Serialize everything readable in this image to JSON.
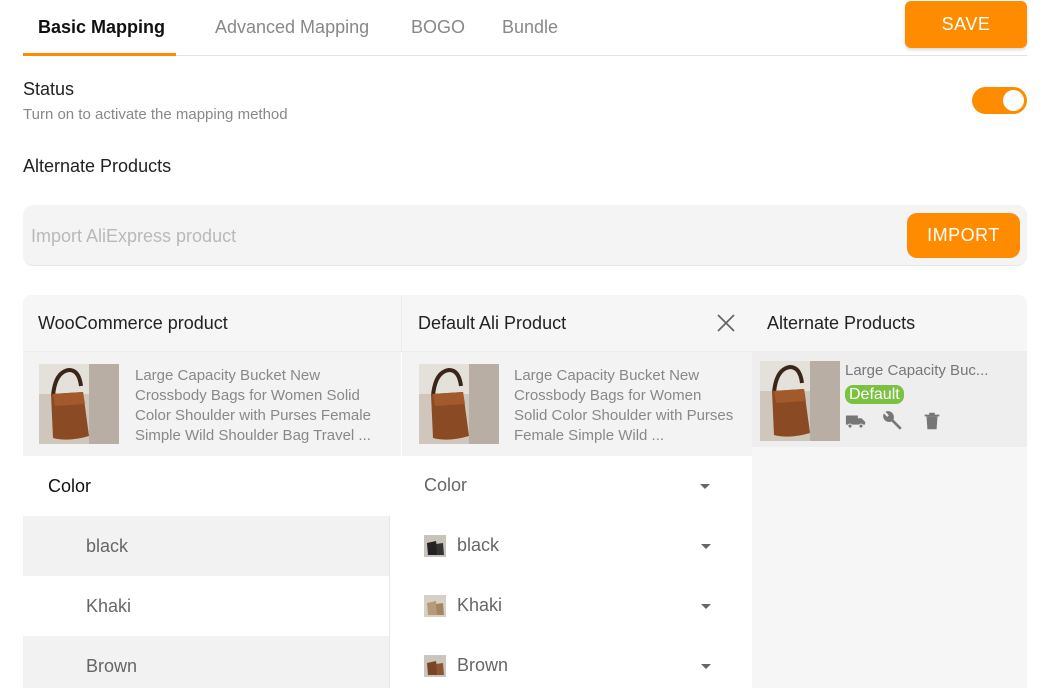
{
  "tabs": [
    {
      "label": "Basic Mapping",
      "active": true
    },
    {
      "label": "Advanced Mapping",
      "active": false
    },
    {
      "label": "BOGO",
      "active": false
    },
    {
      "label": "Bundle",
      "active": false
    }
  ],
  "save_label": "SAVE",
  "status": {
    "title": "Status",
    "description": "Turn on to activate the mapping method",
    "enabled": true
  },
  "alternate_section_title": "Alternate Products",
  "import": {
    "placeholder": "Import AliExpress product",
    "button_label": "IMPORT"
  },
  "columns": {
    "woo": "WooCommerce product",
    "ali": "Default Ali Product",
    "alt": "Alternate Products"
  },
  "woo_product": {
    "title": "Large Capacity Bucket New Crossbody Bags for Women Solid Color Shoulder with Purses Female Simple Wild Shoulder Bag Travel ..."
  },
  "ali_product": {
    "title": "Large Capacity Bucket New Crossbody Bags for Women Solid Color Shoulder with Purses Female Simple Wild ..."
  },
  "alternate_item": {
    "name": "Large Capacity Buc...",
    "badge": "Default"
  },
  "attribute": {
    "name": "Color",
    "select_value": "Color"
  },
  "rows": [
    {
      "woo_value": "black",
      "ali_value": "black"
    },
    {
      "woo_value": "Khaki",
      "ali_value": "Khaki"
    },
    {
      "woo_value": "Brown",
      "ali_value": "Brown"
    }
  ],
  "colors": {
    "accent": "#ff8c00",
    "badge": "#7cc242"
  }
}
